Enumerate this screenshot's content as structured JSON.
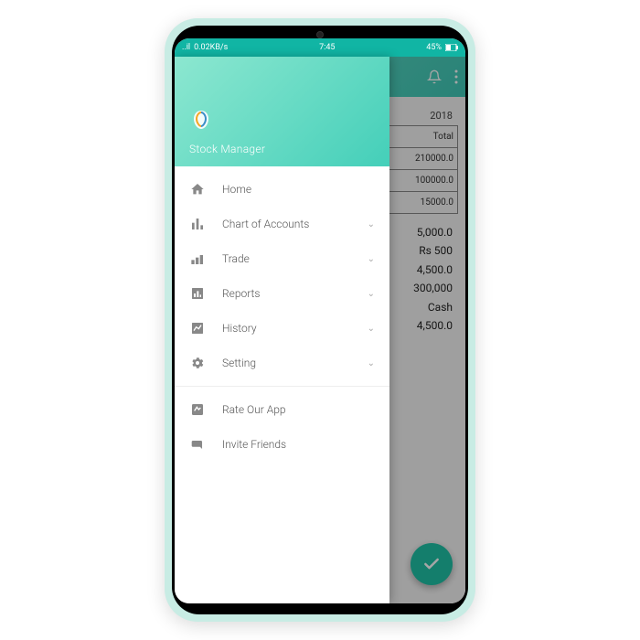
{
  "status": {
    "signal": "..il",
    "net_speed": "0.02KB/s",
    "time": "7:45",
    "battery": "45%"
  },
  "drawer": {
    "title": "Stock Manager",
    "items": [
      {
        "label": "Home",
        "expandable": false
      },
      {
        "label": "Chart of Accounts",
        "expandable": true
      },
      {
        "label": "Trade",
        "expandable": true
      },
      {
        "label": "Reports",
        "expandable": true
      },
      {
        "label": "History",
        "expandable": true
      },
      {
        "label": "Setting",
        "expandable": true
      }
    ],
    "footer_items": [
      {
        "label": "Rate Our App"
      },
      {
        "label": "Invite Friends"
      }
    ]
  },
  "main": {
    "date_partial": "2018",
    "table": {
      "header_right": "Total",
      "rows": [
        {
          "value": "210000.0"
        },
        {
          "value": "100000.0"
        },
        {
          "value": "15000.0"
        }
      ]
    },
    "amounts": [
      "5,000.0",
      "Rs 500",
      "4,500.0",
      "300,000",
      "Cash",
      "4,500.0"
    ]
  }
}
